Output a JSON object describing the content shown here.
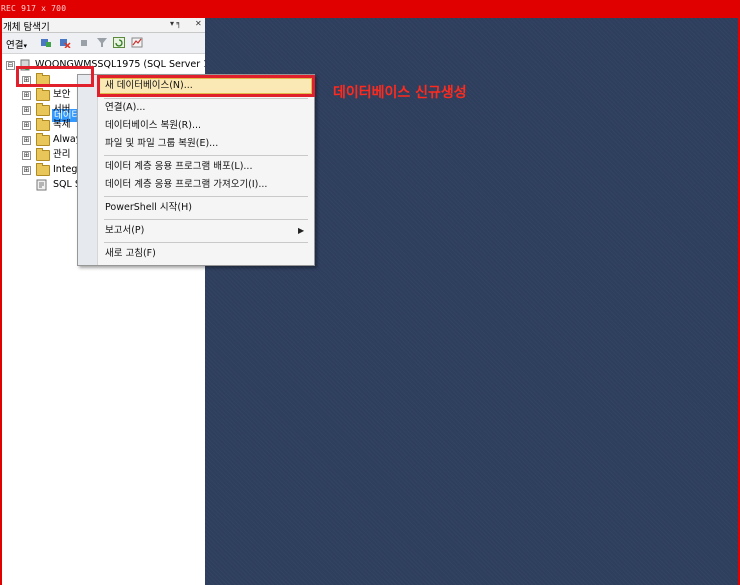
{
  "recording": {
    "label": "REC 917 x 700"
  },
  "panel": {
    "title": "개체 탐색기",
    "pin_glyph": "▾ ╕",
    "close_glyph": "✕",
    "toolbar": {
      "connect_label": "연결",
      "connect_caret": "▾"
    }
  },
  "tree": {
    "root": {
      "expander": "⊟",
      "label": "WOONGWMSSQL1975 (SQL Server 12"
    },
    "items": [
      {
        "expander": "⊞",
        "label": "데이터"
      },
      {
        "expander": "⊞",
        "label": "보안"
      },
      {
        "expander": "⊞",
        "label": "서버"
      },
      {
        "expander": "⊞",
        "label": "복제"
      },
      {
        "expander": "⊞",
        "label": "Alway"
      },
      {
        "expander": "⊞",
        "label": "관리"
      },
      {
        "expander": "⊞",
        "label": "Integ"
      },
      {
        "expander": "",
        "label": "SQL S"
      }
    ]
  },
  "context_menu": {
    "items": [
      {
        "label": "새 데이터베이스(N)...",
        "highlighted": true
      },
      {
        "label": "연결(A)..."
      },
      {
        "label": "데이터베이스 복원(R)..."
      },
      {
        "label": "파일 및 파일 그룹 복원(E)..."
      },
      {
        "label": "데이터 계층 응용 프로그램 배포(L)..."
      },
      {
        "label": "데이터 계층 응용 프로그램 가져오기(I)..."
      },
      {
        "label": "PowerShell 시작(H)"
      },
      {
        "label": "보고서(P)",
        "submenu": true,
        "arrow": "▶"
      },
      {
        "label": "새로 고침(F)"
      }
    ]
  },
  "annotation": {
    "text": "데이터베이스 신규생성",
    "color": "#ff2a1e"
  },
  "colors": {
    "canvas": "#2e3e5d",
    "recording_bar": "#e00000",
    "selection": "#3399ff",
    "menu_highlight": "#fbe9b5"
  }
}
